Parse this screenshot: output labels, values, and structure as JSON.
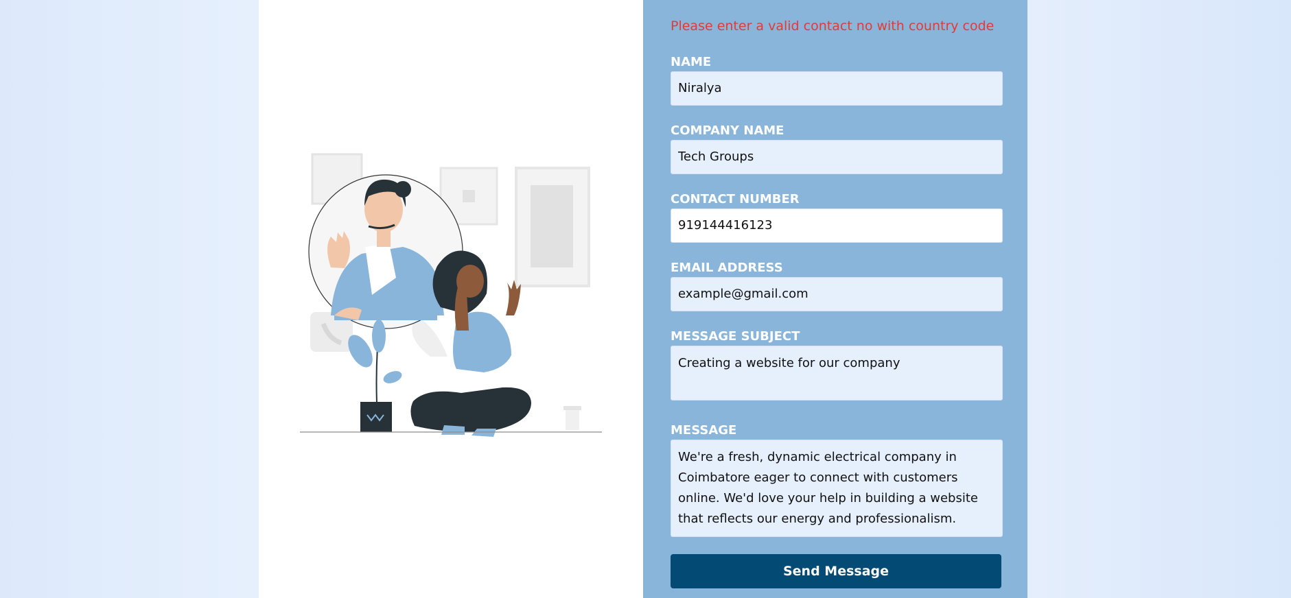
{
  "form": {
    "error_message": "Please enter a valid contact no with country code",
    "fields": {
      "name": {
        "label": "NAME",
        "value": "Niralya"
      },
      "company": {
        "label": "COMPANY NAME",
        "value": "Tech Groups"
      },
      "contact": {
        "label": "CONTACT NUMBER",
        "value": "919144416123"
      },
      "email": {
        "label": "EMAIL ADDRESS",
        "value": "example@gmail.com"
      },
      "subject": {
        "label": "MESSAGE SUBJECT",
        "value": "Creating a website for our company"
      },
      "message": {
        "label": "MESSAGE",
        "value": "We're a fresh, dynamic electrical company in Coimbatore eager to connect with customers online. We'd love your help in building a website that reflects our energy and professionalism."
      }
    },
    "submit_label": "Send Message"
  },
  "colors": {
    "form_panel": "#8ab5da",
    "error": "#e53935",
    "button": "#034a74",
    "field": "#e6effc"
  },
  "illustration": {
    "icon": "customer-support-illustration"
  }
}
